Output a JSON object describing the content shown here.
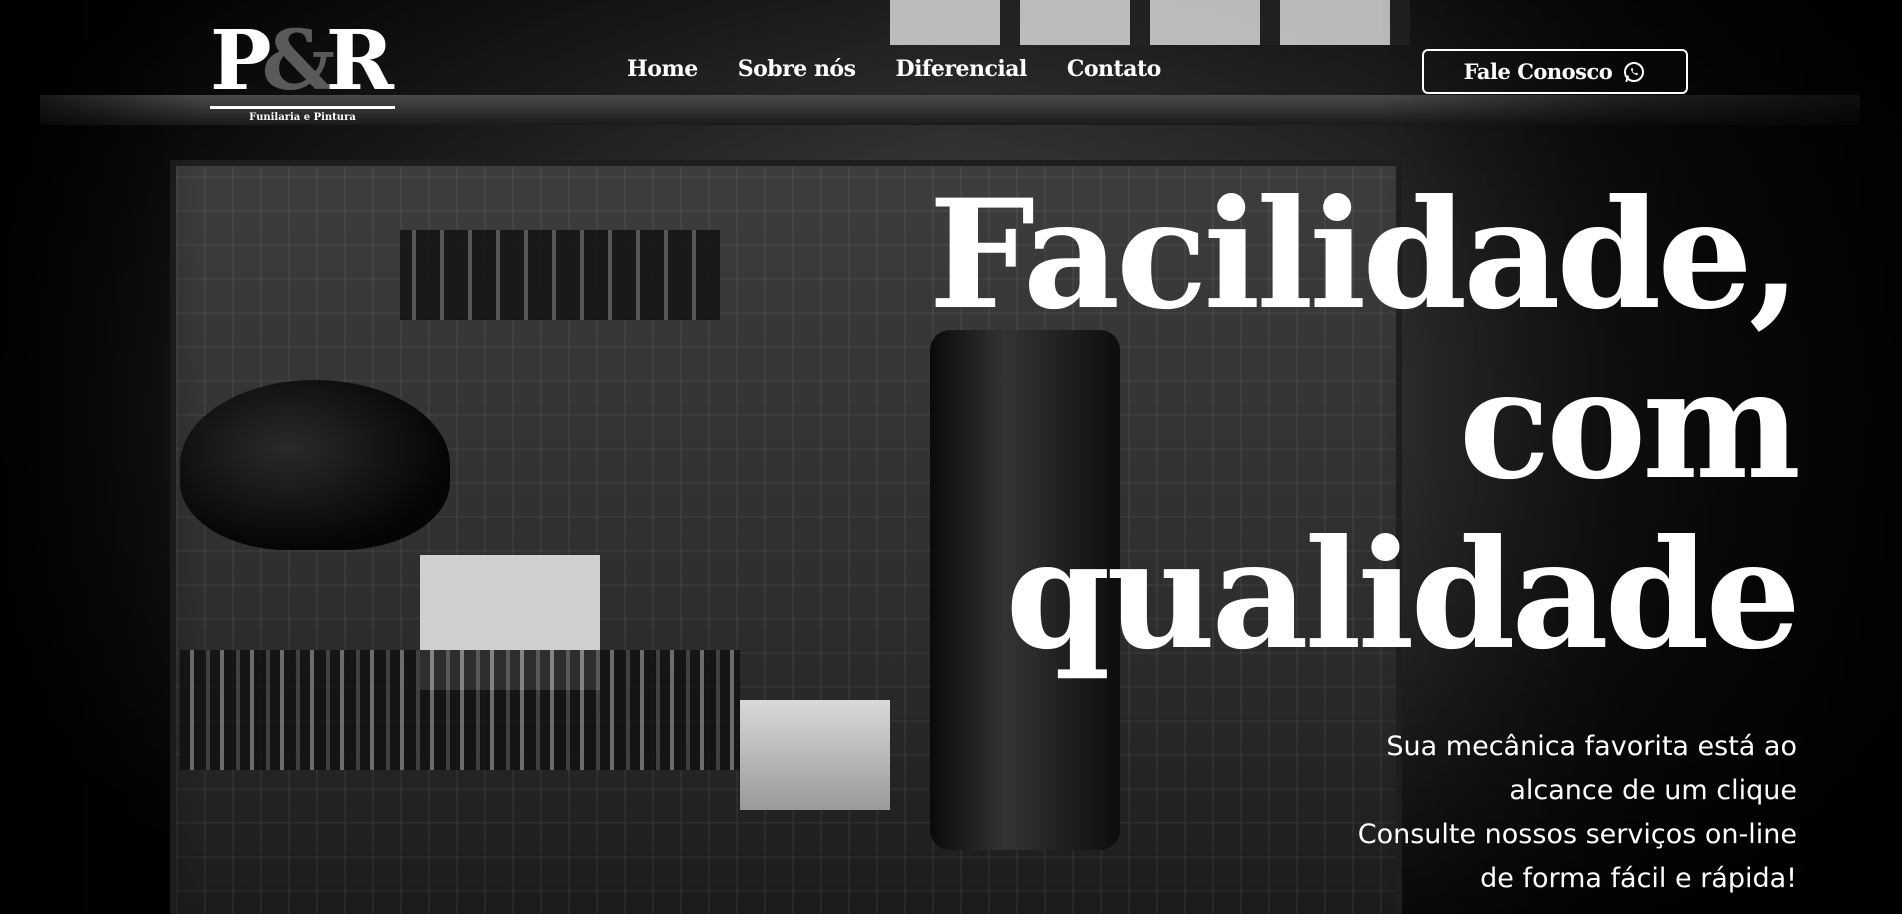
{
  "brand": {
    "logo_text": "P&R",
    "logo_letter_left": "P",
    "logo_ampersand": "&",
    "logo_letter_right": "R",
    "tagline": "Funilaria e Pintura"
  },
  "nav": {
    "items": [
      {
        "label": "Home"
      },
      {
        "label": "Sobre nós"
      },
      {
        "label": "Diferencial"
      },
      {
        "label": "Contato"
      }
    ]
  },
  "cta": {
    "label": "Fale Conosco",
    "icon": "whatsapp-icon"
  },
  "hero": {
    "headline_lines": [
      "Facilidade,",
      "com",
      "qualidade"
    ],
    "subtext_lines": [
      "Sua mecânica favorita está ao",
      "alcance de um clique",
      "Consulte nossos serviços on-line",
      "de forma fácil e rápida!"
    ]
  },
  "colors": {
    "text": "#ffffff",
    "background": "#000000",
    "logo_ampersand": "#5a5a5a"
  }
}
